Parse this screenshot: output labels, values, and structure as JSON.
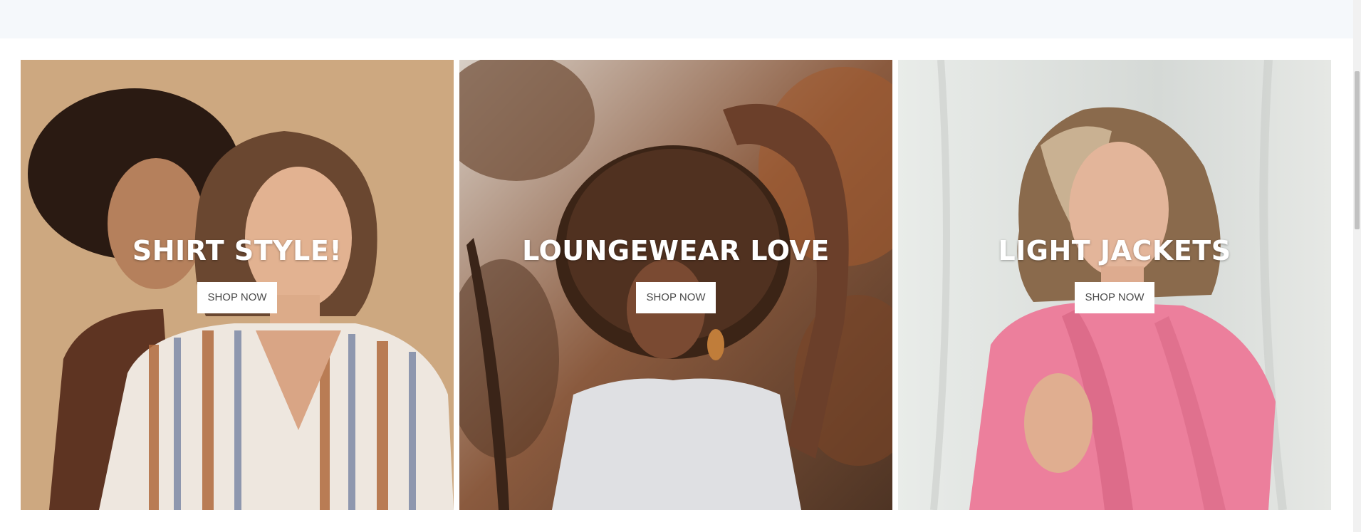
{
  "tiles": [
    {
      "title": "SHIRT STYLE!",
      "button": "SHOP NOW"
    },
    {
      "title": "LOUNGEWEAR LOVE",
      "button": "SHOP NOW"
    },
    {
      "title": "LIGHT JACKETS",
      "button": "SHOP NOW"
    }
  ],
  "colors": {
    "top_band": "#f5f8fb",
    "tile_1_background": "#c9a37c",
    "tile_2_background": "#6e4a34",
    "tile_3_background": "#dfe3e0",
    "button_background": "#ffffff",
    "button_text": "#4a4a4a",
    "title_text": "#ffffff"
  }
}
